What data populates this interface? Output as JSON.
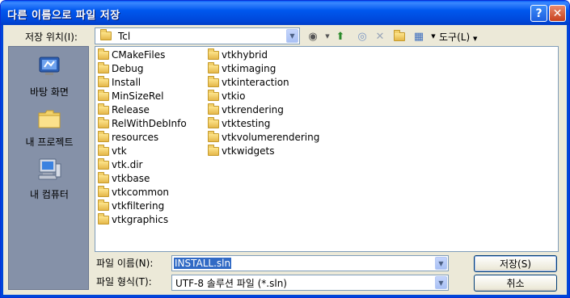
{
  "window": {
    "title": "다른 이름으로 파일 저장",
    "help": "?",
    "close": "✕"
  },
  "toolbar": {
    "save_in_label": "저장 위치(I):",
    "current_folder": "Tcl",
    "tools_label": "도구(L)"
  },
  "places": [
    {
      "label": "바탕 화면",
      "icon": "desktop-icon"
    },
    {
      "label": "내 프로젝트",
      "icon": "folder-icon"
    },
    {
      "label": "내 컴퓨터",
      "icon": "computer-icon"
    }
  ],
  "files": {
    "col1": [
      "CMakeFiles",
      "Debug",
      "Install",
      "MinSizeRel",
      "Release",
      "RelWithDebInfo",
      "resources",
      "vtk",
      "vtk.dir",
      "vtkbase",
      "vtkcommon",
      "vtkfiltering",
      "vtkgraphics"
    ],
    "col2": [
      "vtkhybrid",
      "vtkimaging",
      "vtkinteraction",
      "vtkio",
      "vtkrendering",
      "vtktesting",
      "vtkvolumerendering",
      "vtkwidgets"
    ]
  },
  "form": {
    "filename_label": "파일 이름(N):",
    "filename_value": "INSTALL.sln",
    "filetype_label": "파일 형식(T):",
    "filetype_value": "UTF-8 솔루션 파일 (*.sln)"
  },
  "buttons": {
    "save": "저장(S)",
    "cancel": "취소"
  },
  "colors": {
    "title_bar": "#0058ee",
    "dialog_bg": "#ece9d8",
    "places_bg": "#8591a8"
  }
}
